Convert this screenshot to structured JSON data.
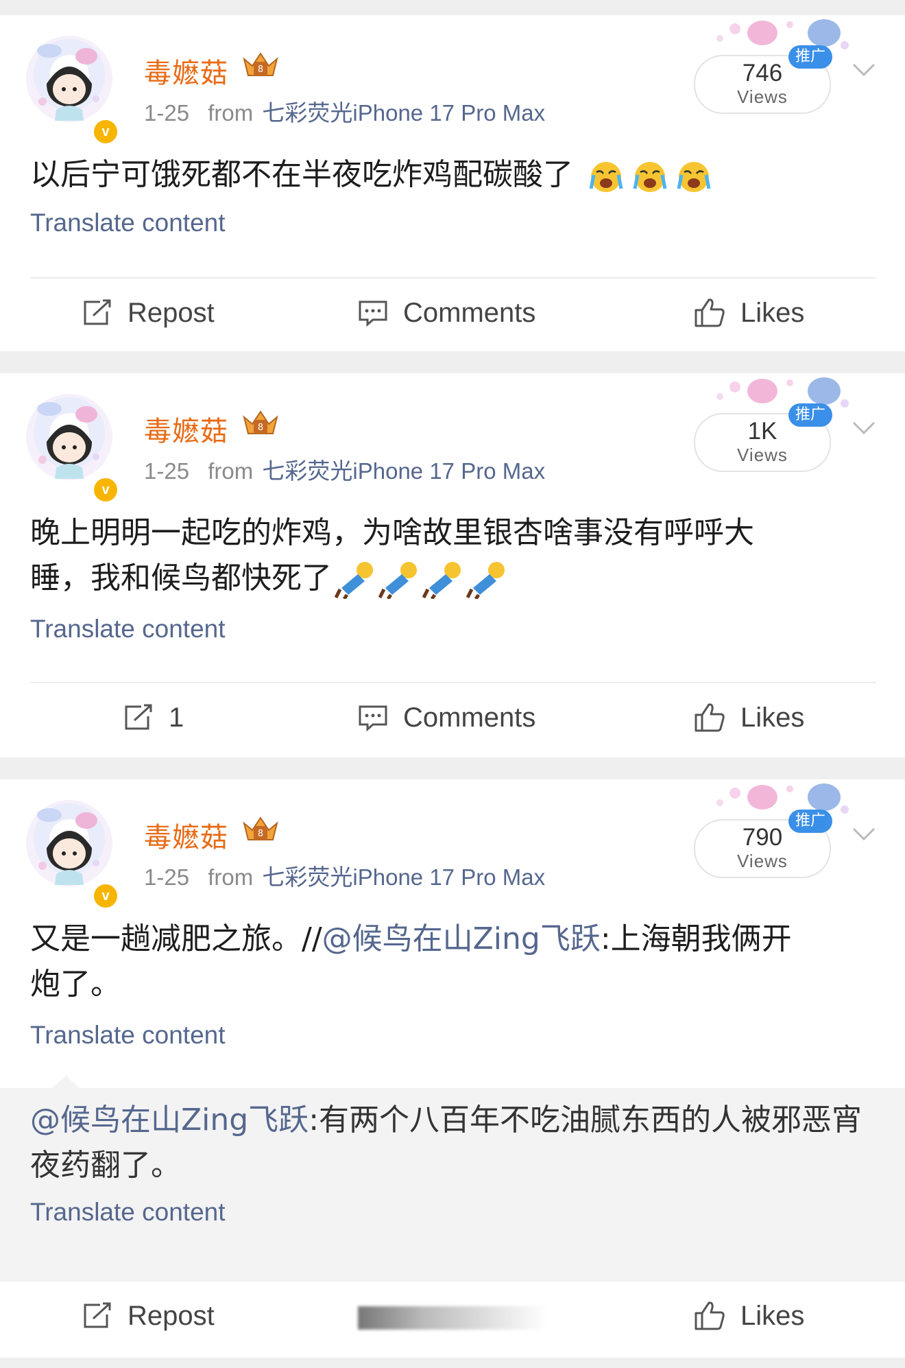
{
  "posts": [
    {
      "username": "毒嬷菇",
      "date": "1-25",
      "from_label": "from",
      "source": "七彩荧光iPhone 17 Pro Max",
      "views": "746",
      "views_label": "Views",
      "promo_badge": "推广",
      "text": "以后宁可饿死都不在半夜吃炸鸡配碳酸了",
      "emoji": [
        "crying-face",
        "crying-face",
        "crying-face"
      ],
      "translate": "Translate content",
      "actions": {
        "repost": "Repost",
        "comments": "Comments",
        "likes": "Likes"
      }
    },
    {
      "username": "毒嬷菇",
      "date": "1-25",
      "from_label": "from",
      "source": "七彩荧光iPhone 17 Pro Max",
      "views": "1K",
      "views_label": "Views",
      "promo_badge": "推广",
      "text_line1": "晚上明明一起吃的炸鸡，为啥故里银杏啥事没有呼呼大",
      "text_line2": "睡，我和候鸟都快死了",
      "emoji": [
        "fallen-figure",
        "fallen-figure",
        "fallen-figure",
        "fallen-figure"
      ],
      "translate": "Translate content",
      "actions": {
        "repost": "1",
        "comments": "Comments",
        "likes": "Likes"
      }
    },
    {
      "username": "毒嬷菇",
      "date": "1-25",
      "from_label": "from",
      "source": "七彩荧光iPhone 17 Pro Max",
      "views": "790",
      "views_label": "Views",
      "promo_badge": "推广",
      "text_before": "又是一趟减肥之旅。//",
      "mention": "@候鸟在山Zing飞跃",
      "text_after_line1": ":上海朝我俩开",
      "text_line2": "炮了。",
      "translate": "Translate content",
      "quote": {
        "mention": "@候鸟在山Zing飞跃",
        "text_line1": ":有两个八百年不吃油腻东西的人被邪恶宵",
        "text_line2": "夜药翻了。",
        "translate": "Translate content"
      },
      "actions": {
        "repost": "Repost",
        "likes": "Likes"
      }
    }
  ],
  "colors": {
    "username": "#e86b16",
    "link": "#55678e",
    "promo_badge": "#3a8fe8",
    "verified_badge": "#f7b500",
    "page_bg": "#efefef"
  },
  "icons": [
    "repost-icon",
    "comments-icon",
    "like-thumb-icon",
    "chevron-down-icon",
    "crown-badge-icon",
    "verified-v-icon"
  ]
}
